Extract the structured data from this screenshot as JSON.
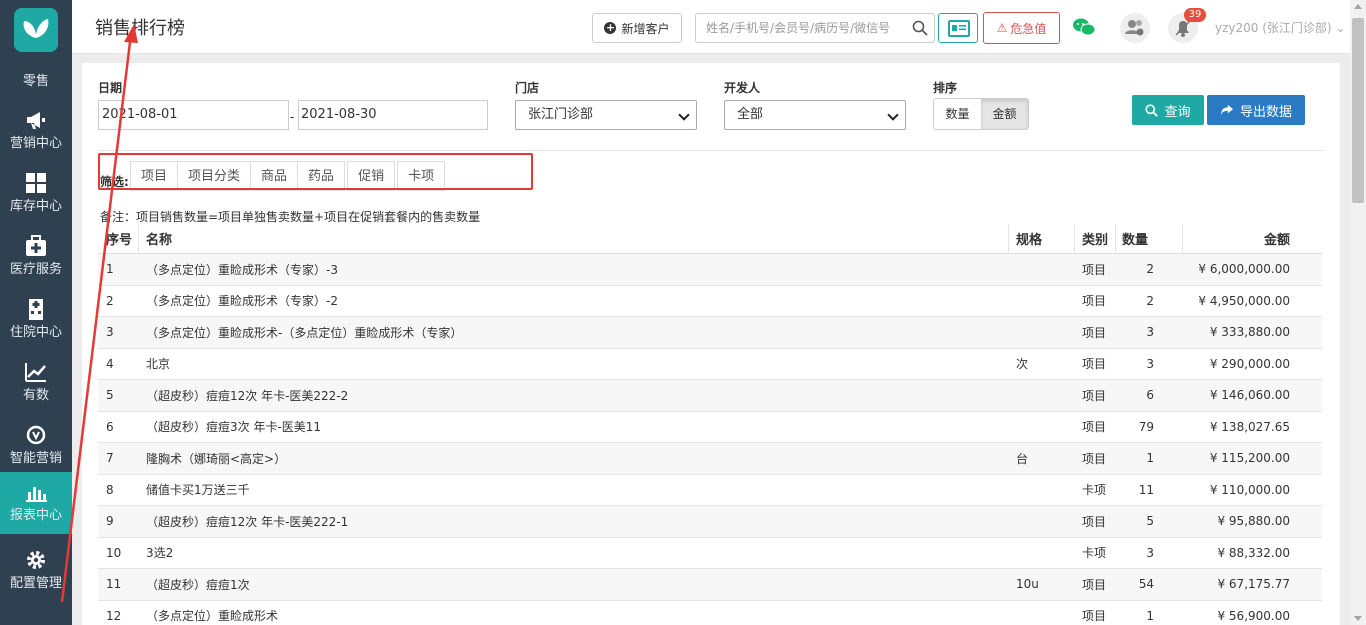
{
  "sidebar": {
    "top_label": "零售",
    "items": [
      {
        "label": "营销中心",
        "icon": "megaphone-icon"
      },
      {
        "label": "库存中心",
        "icon": "grid-icon"
      },
      {
        "label": "医疗服务",
        "icon": "medical-kit-icon"
      },
      {
        "label": "住院中心",
        "icon": "hospital-icon"
      },
      {
        "label": "有数",
        "icon": "trend-icon"
      },
      {
        "label": "智能营销",
        "icon": "brain-icon"
      },
      {
        "label": "报表中心",
        "icon": "bar-chart-icon"
      },
      {
        "label": "配置管理",
        "icon": "gear-icon"
      }
    ]
  },
  "header": {
    "title": "销售排行榜",
    "add_customer": "新增客户",
    "search_placeholder": "姓名/手机号/会员号/病历号/微信号",
    "danger_value": "危急值",
    "notification_count": "39",
    "user": "yzy200 (张江门诊部)"
  },
  "filters": {
    "date_label": "日期",
    "date_start": "2021-08-01",
    "date_sep": "-",
    "date_end": "2021-08-30",
    "store_label": "门店",
    "store_value": "张江门诊部",
    "developer_label": "开发人",
    "developer_value": "全部",
    "sort_label": "排序",
    "sort_options": [
      "数量",
      "金额"
    ],
    "sort_selected": "金额",
    "query_button": "查询",
    "export_button": "导出数据"
  },
  "screen": {
    "label": "筛选:",
    "tabs": [
      "项目",
      "项目分类",
      "商品",
      "药品",
      "促销",
      "卡项"
    ]
  },
  "note": "备注：项目销售数量=项目单独售卖数量+项目在促销套餐内的售卖数量",
  "table": {
    "columns": [
      "序号",
      "名称",
      "规格",
      "类别",
      "数量",
      "金额"
    ],
    "rows": [
      {
        "no": "1",
        "name": "（多点定位）重睑成形术（专家）-3",
        "spec": "",
        "cat": "项目",
        "qty": "2",
        "amt": "¥ 6,000,000.00"
      },
      {
        "no": "2",
        "name": "（多点定位）重睑成形术（专家）-2",
        "spec": "",
        "cat": "项目",
        "qty": "2",
        "amt": "¥ 4,950,000.00"
      },
      {
        "no": "3",
        "name": "（多点定位）重睑成形术-（多点定位）重睑成形术（专家）",
        "spec": "",
        "cat": "项目",
        "qty": "3",
        "amt": "¥ 333,880.00"
      },
      {
        "no": "4",
        "name": "北京",
        "spec": "次",
        "cat": "项目",
        "qty": "3",
        "amt": "¥ 290,000.00"
      },
      {
        "no": "5",
        "name": "（超皮秒）痘痘12次 年卡-医美222-2",
        "spec": "",
        "cat": "项目",
        "qty": "6",
        "amt": "¥ 146,060.00"
      },
      {
        "no": "6",
        "name": "（超皮秒）痘痘3次 年卡-医美11",
        "spec": "",
        "cat": "项目",
        "qty": "79",
        "amt": "¥ 138,027.65"
      },
      {
        "no": "7",
        "name": "隆胸术（娜琦丽<高定>）",
        "spec": "台",
        "cat": "项目",
        "qty": "1",
        "amt": "¥ 115,200.00"
      },
      {
        "no": "8",
        "name": "储值卡买1万送三千",
        "spec": "",
        "cat": "卡项",
        "qty": "11",
        "amt": "¥ 110,000.00"
      },
      {
        "no": "9",
        "name": "（超皮秒）痘痘12次 年卡-医美222-1",
        "spec": "",
        "cat": "项目",
        "qty": "5",
        "amt": "¥ 95,880.00"
      },
      {
        "no": "10",
        "name": "3选2",
        "spec": "",
        "cat": "卡项",
        "qty": "3",
        "amt": "¥ 88,332.00"
      },
      {
        "no": "11",
        "name": "（超皮秒）痘痘1次",
        "spec": "10u",
        "cat": "项目",
        "qty": "54",
        "amt": "¥ 67,175.77"
      },
      {
        "no": "12",
        "name": "（多点定位）重睑成形术",
        "spec": "",
        "cat": "项目",
        "qty": "1",
        "amt": "¥ 56,900.00"
      }
    ]
  },
  "colors": {
    "accent": "#1fa9a5",
    "sidebar": "#2f4050",
    "danger": "#d9534f",
    "export": "#2a7bc4",
    "annotation": "#e53935"
  }
}
